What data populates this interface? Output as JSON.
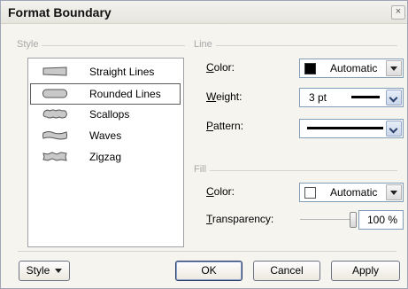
{
  "window": {
    "title": "Format Boundary",
    "close_glyph": "×"
  },
  "style_group": {
    "title": "Style",
    "items": [
      {
        "label": "Straight Lines",
        "icon": "straight-lines-icon",
        "selected": false
      },
      {
        "label": "Rounded Lines",
        "icon": "rounded-lines-icon",
        "selected": true
      },
      {
        "label": "Scallops",
        "icon": "scallops-icon",
        "selected": false
      },
      {
        "label": "Waves",
        "icon": "waves-icon",
        "selected": false
      },
      {
        "label": "Zigzag",
        "icon": "zigzag-icon",
        "selected": false
      }
    ]
  },
  "line_group": {
    "title": "Line",
    "color_label_pre": "",
    "color_label_accel": "C",
    "color_label_post": "olor:",
    "color_value": "Automatic",
    "color_swatch": "#000000",
    "weight_label_accel": "W",
    "weight_label_post": "eight:",
    "weight_value": "3 pt",
    "pattern_label_accel": "P",
    "pattern_label_post": "attern:"
  },
  "fill_group": {
    "title": "Fill",
    "color_label_accel": "C",
    "color_label_post": "olor:",
    "color_value": "Automatic",
    "color_swatch": "#ffffff",
    "transparency_label_accel": "T",
    "transparency_label_post": "ransparency:",
    "transparency_value": "100 %",
    "transparency_level": 1.0
  },
  "buttons": {
    "style": "Style",
    "ok": "OK",
    "cancel": "Cancel",
    "apply": "Apply"
  },
  "colors": {
    "dialog_bg": "#f5f4ef",
    "border": "#7f9db9",
    "group_title": "#a8a8a8"
  }
}
